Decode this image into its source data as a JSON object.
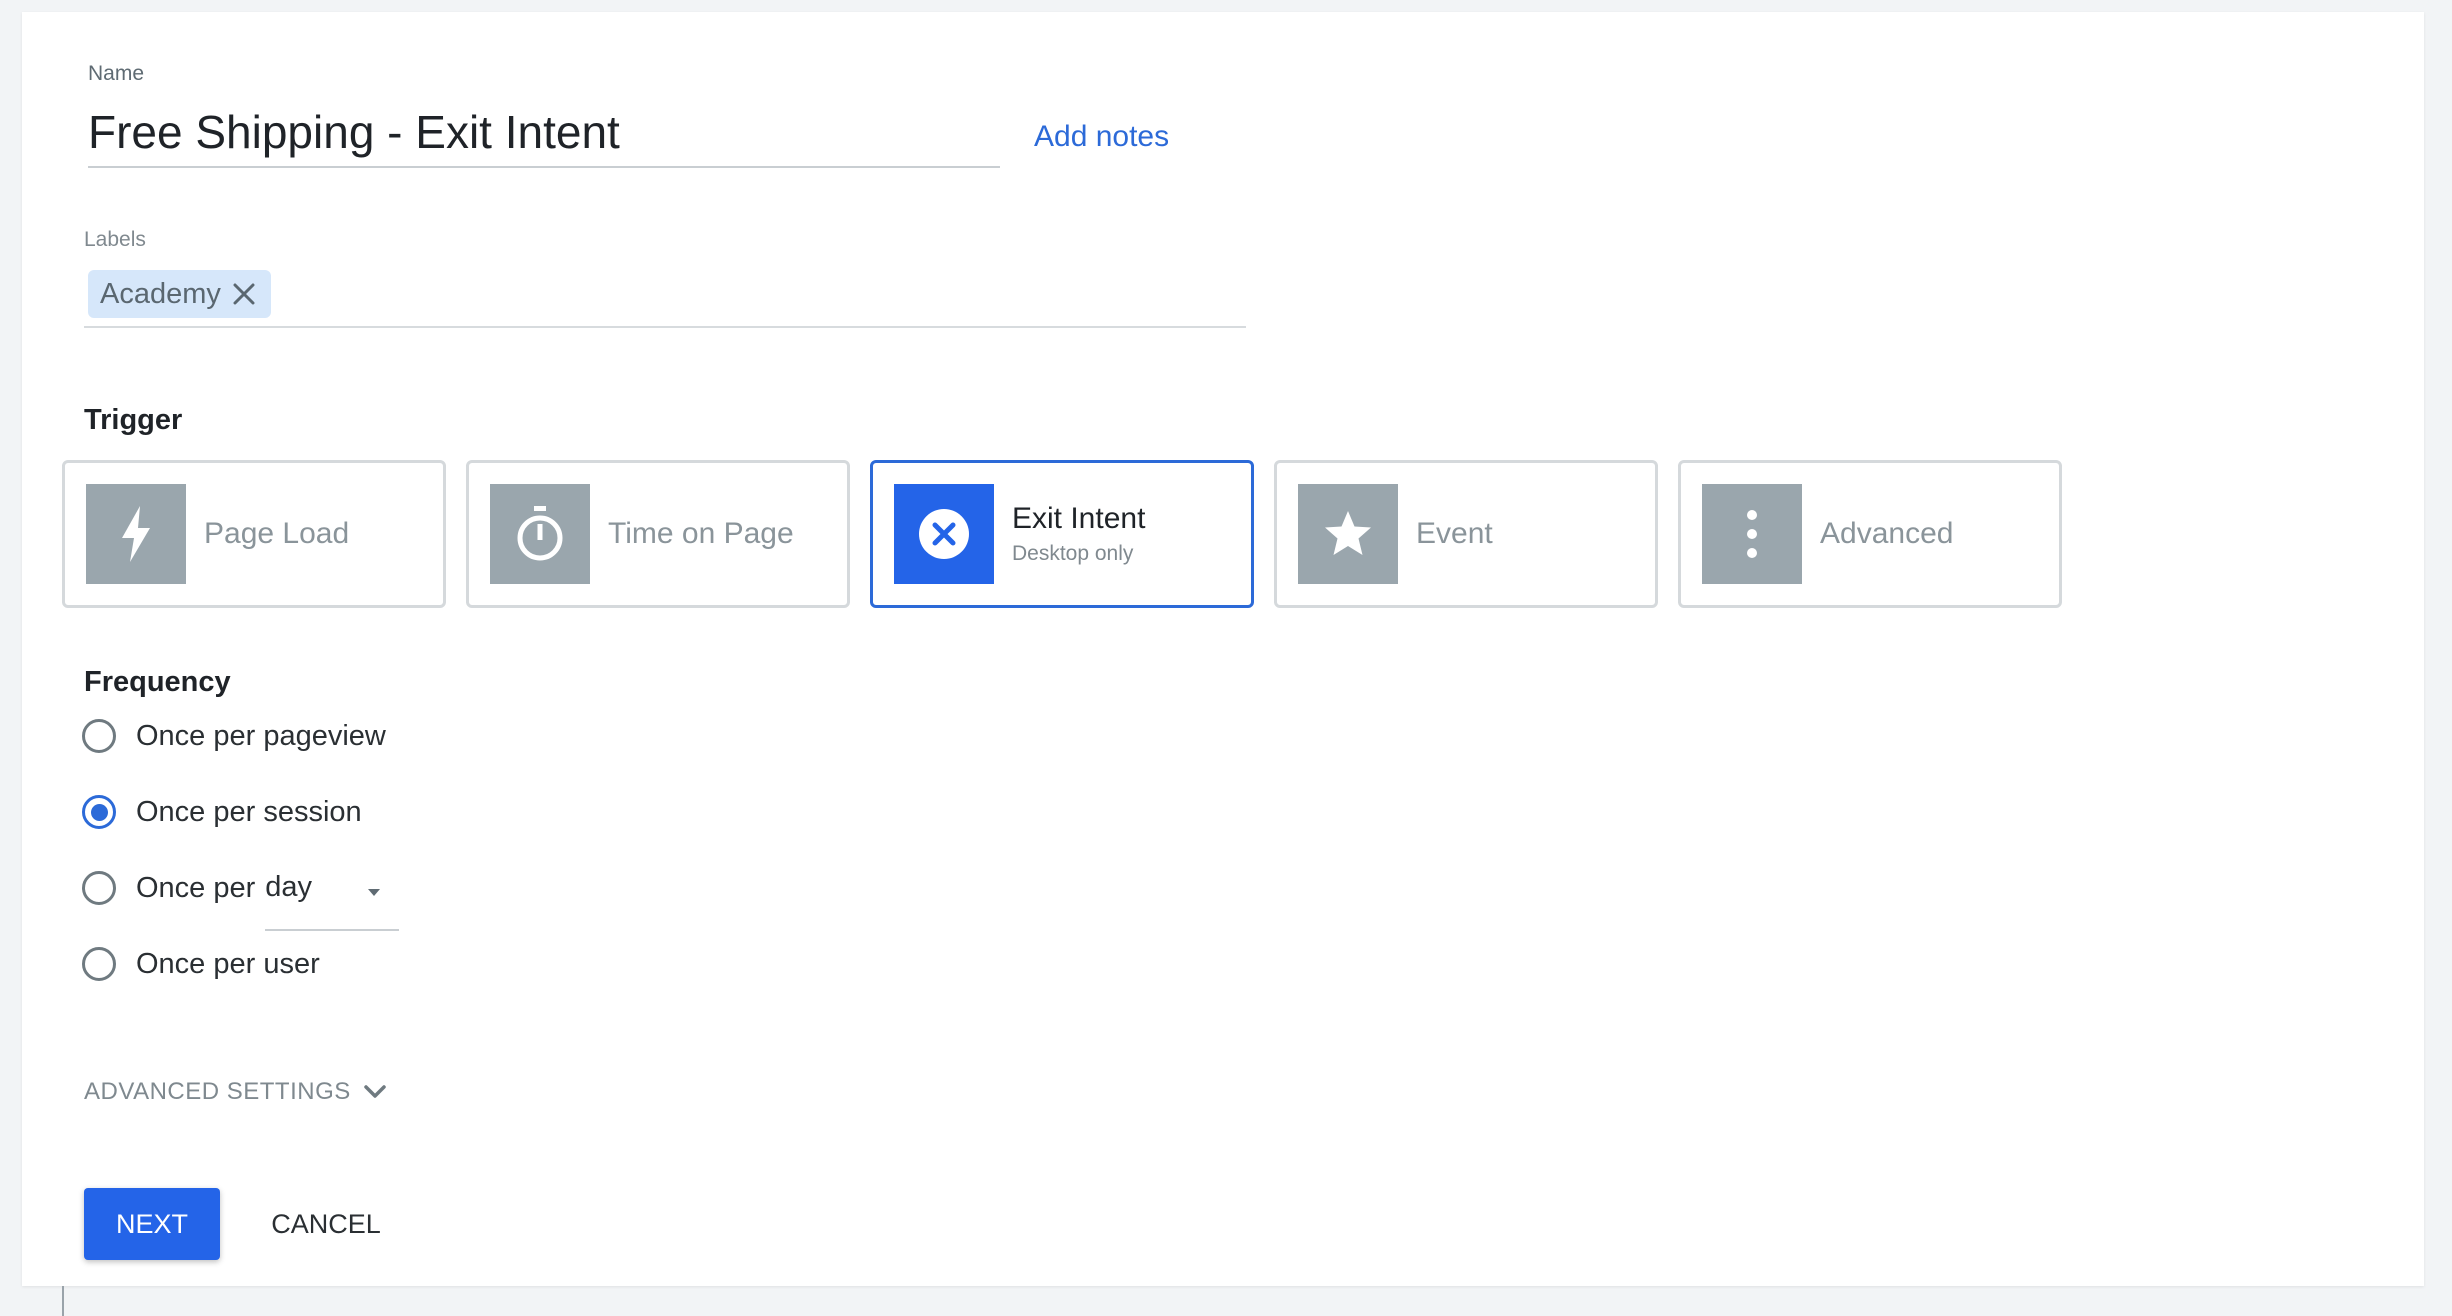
{
  "form": {
    "name_label": "Name",
    "name_value": "Free Shipping - Exit Intent",
    "add_notes": "Add notes",
    "labels_label": "Labels",
    "labels": [
      "Academy"
    ]
  },
  "trigger": {
    "title": "Trigger",
    "options": [
      {
        "label": "Page Load",
        "sub": "",
        "icon": "lightning-bolt-icon",
        "selected": false
      },
      {
        "label": "Time on Page",
        "sub": "",
        "icon": "stopwatch-icon",
        "selected": false
      },
      {
        "label": "Exit Intent",
        "sub": "Desktop only",
        "icon": "close-circle-icon",
        "selected": true
      },
      {
        "label": "Event",
        "sub": "",
        "icon": "star-icon",
        "selected": false
      },
      {
        "label": "Advanced",
        "sub": "",
        "icon": "more-vertical-icon",
        "selected": false
      }
    ]
  },
  "frequency": {
    "title": "Frequency",
    "options": [
      {
        "label": "Once per pageview",
        "checked": false
      },
      {
        "label": "Once per session",
        "checked": true
      },
      {
        "label": "Once per",
        "checked": false,
        "select_value": "day"
      },
      {
        "label": "Once per user",
        "checked": false
      }
    ]
  },
  "advanced_settings": "ADVANCED SETTINGS",
  "buttons": {
    "next": "NEXT",
    "cancel": "CANCEL"
  },
  "colors": {
    "accent": "#2464e8",
    "link": "#2c6ad8",
    "chip_bg": "#d6e7fa",
    "icon_tile": "#9aa6ad"
  }
}
